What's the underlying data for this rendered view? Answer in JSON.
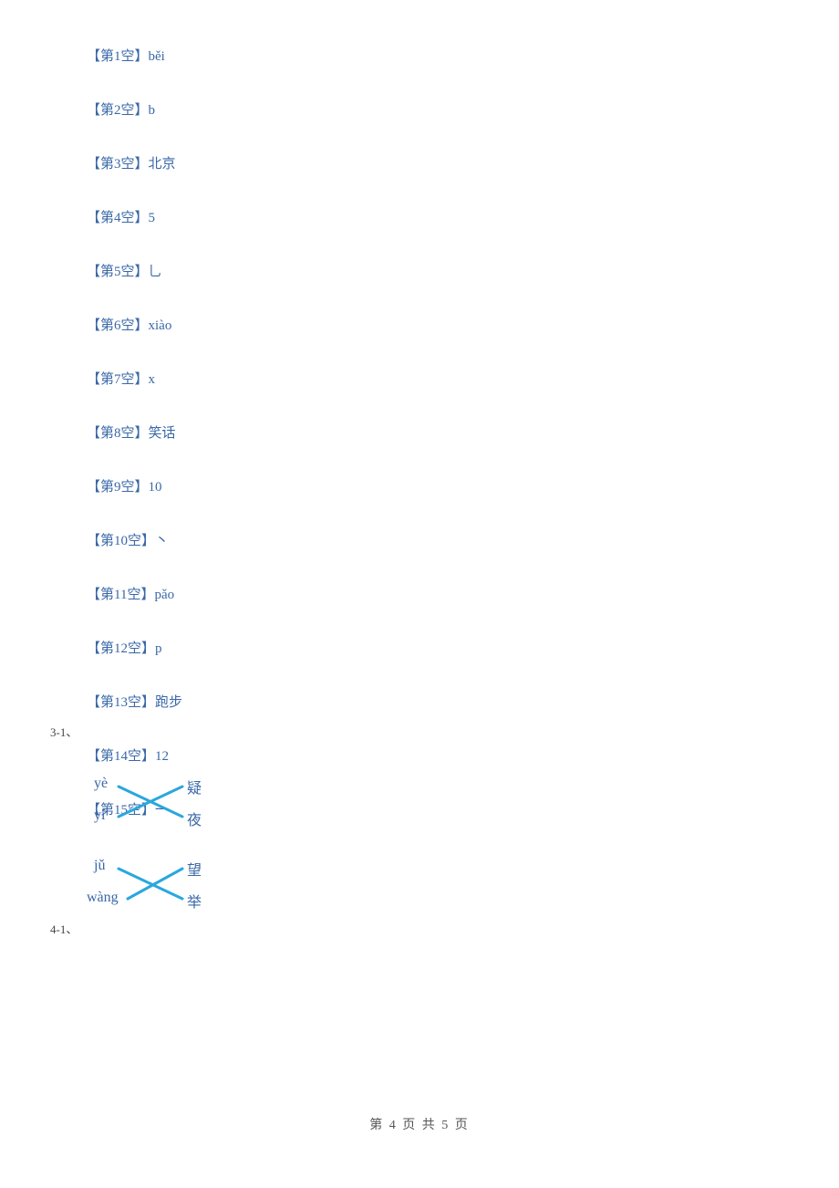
{
  "answers": {
    "a1": {
      "label": "【第1空】",
      "value": "běi"
    },
    "a2": {
      "label": "【第2空】",
      "value": "b"
    },
    "a3": {
      "label": "【第3空】",
      "value": "北京"
    },
    "a4": {
      "label": "【第4空】",
      "value": "5"
    },
    "a5": {
      "label": "【第5空】",
      "value": "乚"
    },
    "a6": {
      "label": "【第6空】",
      "value": "xiào"
    },
    "a7": {
      "label": "【第7空】",
      "value": "x"
    },
    "a8": {
      "label": "【第8空】",
      "value": "笑话"
    },
    "a9": {
      "label": "【第9空】",
      "value": "10"
    },
    "a10": {
      "label": "【第10空】",
      "value": "丶"
    },
    "a11": {
      "label": "【第11空】",
      "value": "pǎo"
    },
    "a12": {
      "label": "【第12空】",
      "value": "p"
    },
    "a13": {
      "label": "【第13空】",
      "value": "跑步"
    },
    "a14": {
      "label": "【第14空】",
      "value": "12"
    },
    "a15": {
      "label": "【第15空】",
      "value": "一"
    }
  },
  "item_numbers": {
    "n3": "3-1、",
    "n4": "4-1、"
  },
  "matching": {
    "left": {
      "l1": "yè",
      "l2": "yí",
      "l3": "jǔ",
      "l4": "wàng"
    },
    "right": {
      "r1": "疑",
      "r2": "夜",
      "r3": "望",
      "r4": "举"
    }
  },
  "footer": "第 4 页 共 5 页"
}
